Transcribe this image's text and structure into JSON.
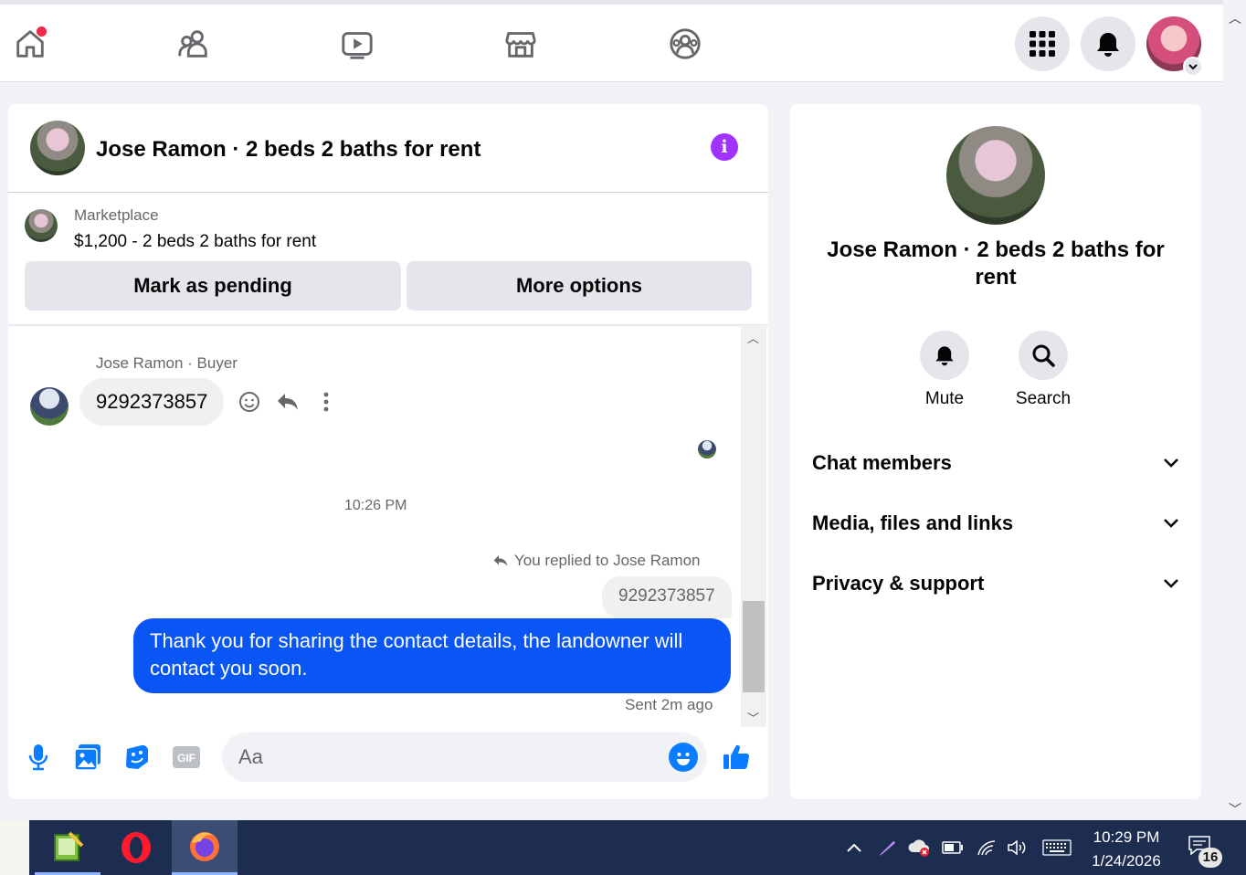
{
  "chat": {
    "title": "Jose Ramon · 2 beds 2 baths for rent",
    "info_icon": "i",
    "marketplace": {
      "label": "Marketplace",
      "listing": "$1,200 - 2 beds 2 baths for rent",
      "mark_pending": "Mark as pending",
      "more_options": "More options"
    },
    "messages": {
      "sender": "Jose Ramon · Buyer",
      "incoming": "9292373857",
      "time": "10:26 PM",
      "replied_to": "You replied to Jose Ramon",
      "quoted": "9292373857",
      "outgoing": "Thank you for sharing the contact details, the landowner will contact you soon.",
      "status": "Sent 2m ago"
    },
    "composer": {
      "placeholder": "Aa",
      "gif": "GIF"
    }
  },
  "details": {
    "title": "Jose Ramon · 2 beds 2 baths for rent",
    "mute": "Mute",
    "search": "Search",
    "sections": [
      "Chat members",
      "Media, files and links",
      "Privacy & support"
    ]
  },
  "taskbar": {
    "time": "10:29 PM",
    "date": "1/24/2026",
    "notifications": "16"
  },
  "colors": {
    "accent": "#0a56f5",
    "info": "#a033ff",
    "badge": "#f02849"
  }
}
